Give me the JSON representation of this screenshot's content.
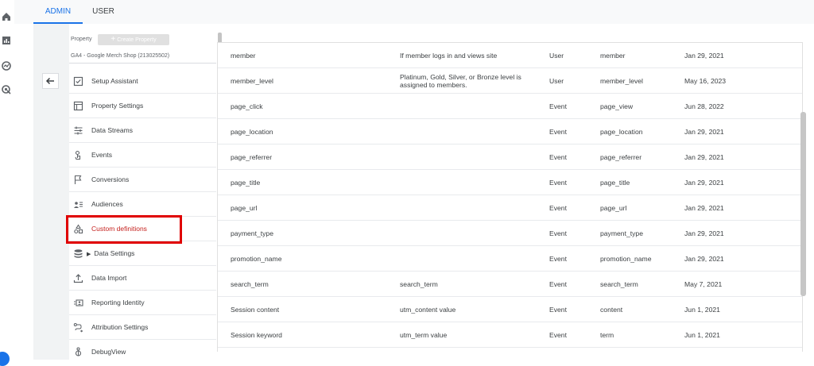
{
  "tabs": {
    "admin": "ADMIN",
    "user": "USER"
  },
  "property": {
    "label": "Property",
    "create_button": "Create Property",
    "name": "GA4 - Google Merch Shop (213025502)"
  },
  "nav": [
    {
      "label": "Setup Assistant",
      "icon": "checkbox-icon"
    },
    {
      "label": "Property Settings",
      "icon": "property-settings-icon"
    },
    {
      "label": "Data Streams",
      "icon": "data-streams-icon"
    },
    {
      "label": "Events",
      "icon": "events-icon"
    },
    {
      "label": "Conversions",
      "icon": "flag-icon"
    },
    {
      "label": "Audiences",
      "icon": "audiences-icon"
    },
    {
      "label": "Custom definitions",
      "icon": "shapes-icon"
    },
    {
      "label": "Data Settings",
      "icon": "database-icon"
    },
    {
      "label": "Data Import",
      "icon": "upload-icon"
    },
    {
      "label": "Reporting Identity",
      "icon": "reporting-identity-icon"
    },
    {
      "label": "Attribution Settings",
      "icon": "attribution-icon"
    },
    {
      "label": "DebugView",
      "icon": "debug-icon"
    }
  ],
  "active_nav": "Custom definitions",
  "accent_color": "#1a73e8",
  "highlight_color": "#e00000",
  "rows": [
    {
      "name": "member",
      "description": "If member logs in and views site",
      "scope": "User",
      "parameter": "member",
      "modified": "Jan 29, 2021"
    },
    {
      "name": "member_level",
      "description": "Platinum, Gold, Silver, or Bronze level is assigned to members.",
      "scope": "User",
      "parameter": "member_level",
      "modified": "May 16, 2023"
    },
    {
      "name": "page_click",
      "description": "",
      "scope": "Event",
      "parameter": "page_view",
      "modified": "Jun 28, 2022"
    },
    {
      "name": "page_location",
      "description": "",
      "scope": "Event",
      "parameter": "page_location",
      "modified": "Jan 29, 2021"
    },
    {
      "name": "page_referrer",
      "description": "",
      "scope": "Event",
      "parameter": "page_referrer",
      "modified": "Jan 29, 2021"
    },
    {
      "name": "page_title",
      "description": "",
      "scope": "Event",
      "parameter": "page_title",
      "modified": "Jan 29, 2021"
    },
    {
      "name": "page_url",
      "description": "",
      "scope": "Event",
      "parameter": "page_url",
      "modified": "Jan 29, 2021"
    },
    {
      "name": "payment_type",
      "description": "",
      "scope": "Event",
      "parameter": "payment_type",
      "modified": "Jan 29, 2021"
    },
    {
      "name": "promotion_name",
      "description": "",
      "scope": "Event",
      "parameter": "promotion_name",
      "modified": "Jan 29, 2021"
    },
    {
      "name": "search_term",
      "description": "search_term",
      "scope": "Event",
      "parameter": "search_term",
      "modified": "May 7, 2021"
    },
    {
      "name": "Session content",
      "description": "utm_content value",
      "scope": "Event",
      "parameter": "content",
      "modified": "Jun 1, 2021"
    },
    {
      "name": "Session keyword",
      "description": "utm_term value",
      "scope": "Event",
      "parameter": "term",
      "modified": "Jun 1, 2021"
    }
  ]
}
